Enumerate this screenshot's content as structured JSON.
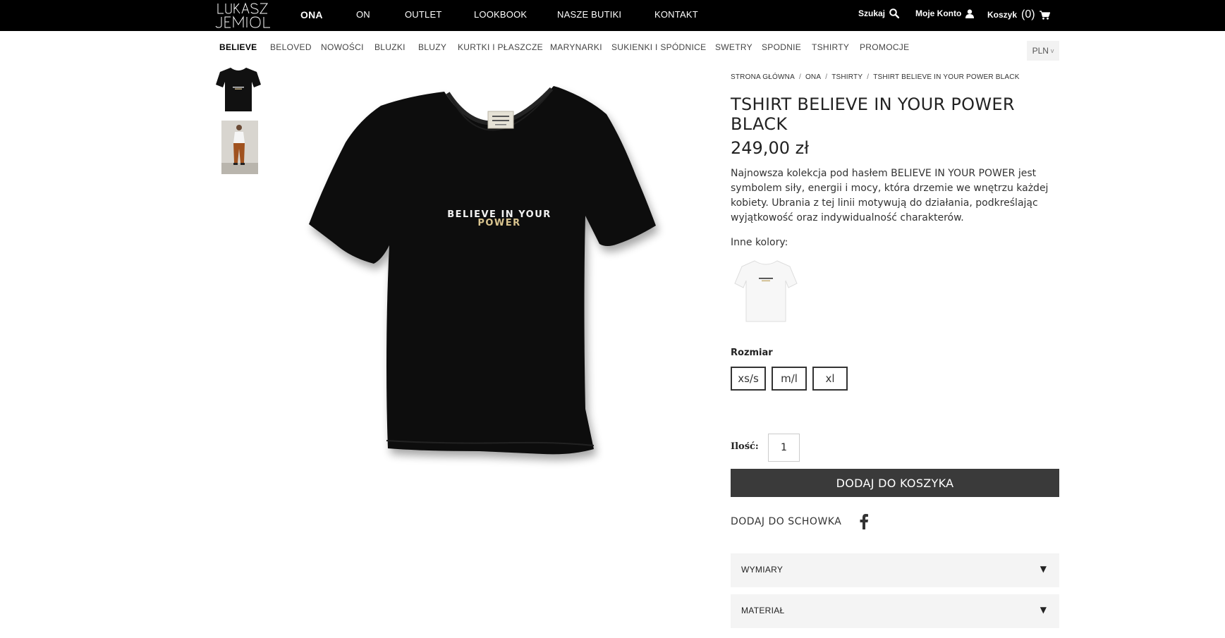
{
  "brand": {
    "logo_text": "LUKASZ JEMIOL"
  },
  "main_nav": [
    {
      "label": "ONA",
      "active": true
    },
    {
      "label": "ON",
      "active": false
    },
    {
      "label": "OUTLET",
      "active": false
    },
    {
      "label": "LOOKBOOK",
      "active": false
    },
    {
      "label": "NASZE BUTIKI",
      "active": false
    },
    {
      "label": "KONTAKT",
      "active": false
    }
  ],
  "utilities": {
    "search_label": "Szukaj",
    "search_icon": "search-icon",
    "account_label": "Moje Konto",
    "account_icon": "user-icon",
    "cart_label": "Koszyk",
    "cart_count": "(0)",
    "cart_icon": "cart-icon"
  },
  "sub_nav": [
    {
      "label": "BELIEVE",
      "active": true
    },
    {
      "label": "BELOVED",
      "active": false
    },
    {
      "label": "NOWOŚCI",
      "active": false
    },
    {
      "label": "BLUZKI",
      "active": false
    },
    {
      "label": "BLUZY",
      "active": false
    },
    {
      "label": "KURTKI I PŁASZCZE",
      "active": false
    },
    {
      "label": "MARYNARKI",
      "active": false
    },
    {
      "label": "SUKIENKI I SPÓDNICE",
      "active": false
    },
    {
      "label": "SWETRY",
      "active": false
    },
    {
      "label": "SPODNIE",
      "active": false
    },
    {
      "label": "TSHIRTY",
      "active": false
    },
    {
      "label": "PROMOCJE",
      "active": false
    }
  ],
  "currency": {
    "value": "PLN",
    "chevron": "v"
  },
  "product_image": {
    "print_line1": "BELIEVE IN YOUR",
    "print_line2": "POWER"
  },
  "breadcrumb": [
    "STRONA GŁÓWNA",
    "ONA",
    "TSHIRTY",
    "TSHIRT BELIEVE IN YOUR POWER BLACK"
  ],
  "breadcrumb_separator": "/",
  "product": {
    "title": "TSHIRT BELIEVE IN YOUR POWER BLACK",
    "price": "249,00 zł",
    "description": "Najnowsza kolekcja pod hasłem BELIEVE IN YOUR POWER jest symbolem siły, energii i mocy, która drzemie we wnętrzu każdej kobiety. Ubrania z tej linii motywują do działania, podkreślając wyjątkowość oraz indywidualność charakterów.",
    "other_colors_label": "Inne kolory:",
    "size_label": "Rozmiar",
    "sizes": [
      "xs/s",
      "m/l",
      "xl"
    ],
    "quantity_label": "Ilość:",
    "quantity_value": "1",
    "add_to_cart": "DODAJ DO KOSZYKA",
    "wishlist": "DODAJ DO SCHOWKA",
    "accordions": [
      {
        "label": "WYMIARY",
        "arrow": "▼"
      },
      {
        "label": "MATERIAŁ",
        "arrow": "▼"
      }
    ]
  },
  "colors": {
    "topbar": "#000000",
    "button": "#3a3a3a",
    "accordion_bg": "#f4f4f4",
    "print_gold": "#d9c48f"
  }
}
